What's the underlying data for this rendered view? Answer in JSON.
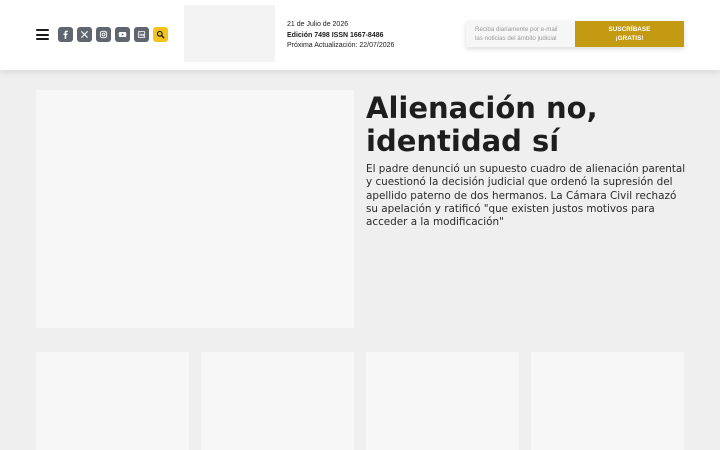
{
  "header": {
    "menu_icon": "hamburger-menu-icon",
    "social_icons": [
      "facebook-icon",
      "x-icon",
      "instagram-icon",
      "youtube-icon",
      "linkedin-icon"
    ],
    "search_icon": "search-icon",
    "date": "21 de Julio de 2026",
    "edition": "Edición 7498 ISSN 1667-8486",
    "next_update": "Próxima Actualización: 22/07/2026",
    "newsletter": {
      "placeholder_line1": "Reciba diariamente por e-mail",
      "placeholder_line2": "las noticias del ámbito judicial",
      "button_line1": "SUSCRÍBASE",
      "button_line2": "¡GRATIS!"
    }
  },
  "hero": {
    "title_line1": "Alienación no,",
    "title_line2": "identidad sí",
    "summary": "El padre denunció un supuesto cuadro de alienación parental y cuestionó la decisión judicial que ordenó la supresión del apellido paterno de dos hermanos. La Cámara Civil rechazó su apelación y ratificó \"que existen justos motivos para acceder a la modificación\""
  },
  "colors": {
    "accent": "#c49a12",
    "search_button": "#f4c21c",
    "social_bg": "#5f6670",
    "page_bg": "#efefef"
  }
}
